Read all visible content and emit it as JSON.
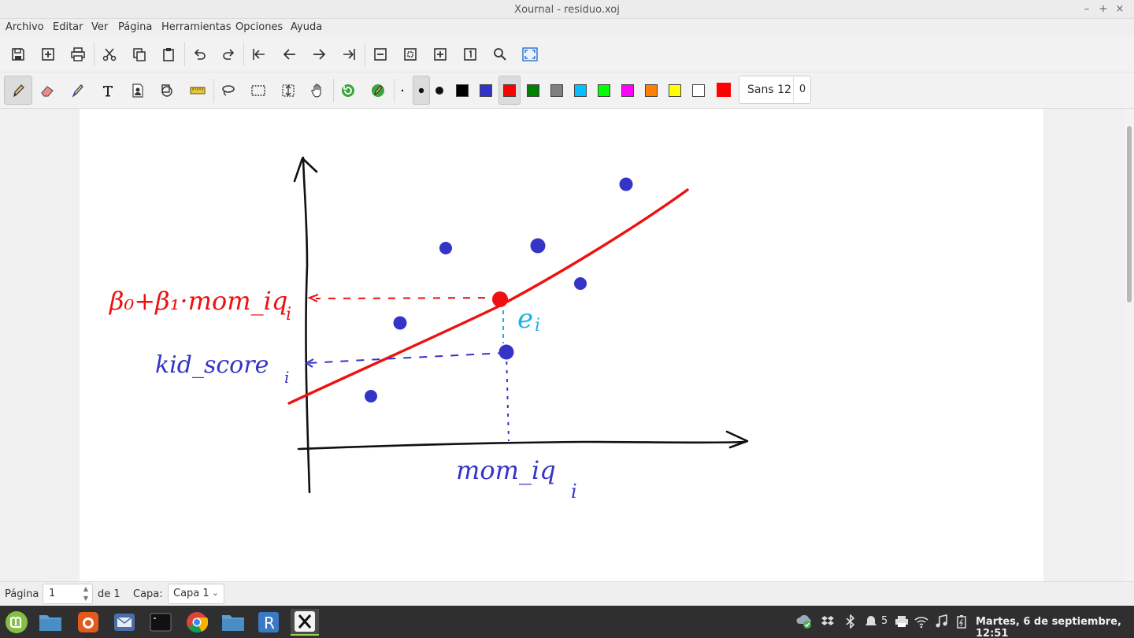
{
  "window": {
    "title": "Xournal - residuo.xoj",
    "min_glyph": "–",
    "max_glyph": "+",
    "close_glyph": "×"
  },
  "menu": [
    "Archivo",
    "Editar",
    "Ver",
    "Página",
    "Herramientas",
    "Opciones",
    "Ayuda"
  ],
  "toolbar": {
    "font_name": "Sans 12",
    "font_size": "0",
    "colors": [
      "#000000",
      "#3333cc",
      "#ff0000",
      "#008000",
      "#808080",
      "#00c0ff",
      "#00ff00",
      "#ff00ff",
      "#ff8000",
      "#ffff00",
      "#ffffff"
    ],
    "selected_color": "#ff0000",
    "current_color": "#ff0000"
  },
  "drawing": {
    "label_fitted": "β₀+β₁·mom_iq",
    "label_fitted_sub": "i",
    "label_residual": "e",
    "label_residual_sub": "i",
    "label_observed": "kid_score",
    "label_observed_sub": "i",
    "label_x": "mom_iq",
    "label_x_sub": "i",
    "colors": {
      "axes": "#111111",
      "line": "#ee1111",
      "points": "#3434c8",
      "residual": "#19b4e6"
    }
  },
  "status": {
    "page_label": "Página",
    "page_value": "1",
    "page_of": "de 1",
    "layer_label": "Capa:",
    "layer_value": "Capa 1"
  },
  "taskbar": {
    "tray_count": "5",
    "clock": "Martes, 6 de septiembre, 12:51"
  }
}
